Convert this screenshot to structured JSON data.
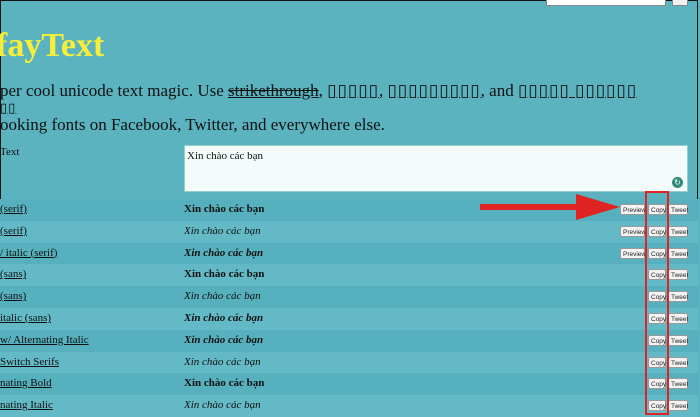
{
  "header": {
    "logo": "fayText"
  },
  "intro": {
    "line1_start": "per cool unicode text magic. Use ",
    "line1_strike": "strikethrough",
    "line1_sep1": ", ",
    "line1_box1": "▯▯▯▯▯",
    "line1_sep2": ", ",
    "line1_box2": "▯▯▯▯▯▯▯▯▯",
    "line1_and": ", and ",
    "line1_box3": "▯▯▯▯▯ ▯▯▯▯▯▯",
    "line2_box": "▯▯",
    "line3": "ooking fonts on Facebook, Twitter, and everywhere else."
  },
  "input": {
    "label": "Text",
    "value": "Xin chào các bạn"
  },
  "buttons": {
    "preview": "Preview",
    "copy": "Copy",
    "tweet": "Tweet"
  },
  "rows": [
    {
      "name": "(serif)",
      "sample": "Xin chào các bạn",
      "style": "b",
      "preview": true
    },
    {
      "name": "(serif)",
      "sample": "Xin chào các bạn",
      "style": "i",
      "preview": true
    },
    {
      "name": "/ italic (serif)",
      "sample": "Xin chào các bạn",
      "style": "bi",
      "preview": true
    },
    {
      "name": "(sans)",
      "sample": "Xin chào các bạn",
      "style": "b",
      "preview": false
    },
    {
      "name": "(sans)",
      "sample": "Xin chào các bạn",
      "style": "i",
      "preview": false
    },
    {
      "name": "italic (sans)",
      "sample": "Xin chào các bạn",
      "style": "bi",
      "preview": false
    },
    {
      "name": "w/ Alternating Italic",
      "sample": "Xin chào các bạn",
      "style": "bi",
      "preview": false
    },
    {
      "name": "Switch Serifs",
      "sample": "Xin chào các bạn",
      "style": "i",
      "preview": false
    },
    {
      "name": "nating Bold",
      "sample": "Xin chào các bạn",
      "style": "b",
      "preview": false
    },
    {
      "name": "nating Italic",
      "sample": "Xin chào các bạn",
      "style": "i",
      "preview": false
    }
  ],
  "annotation": {
    "highlight_color": "#e02424",
    "arrow_color": "#e02424"
  }
}
